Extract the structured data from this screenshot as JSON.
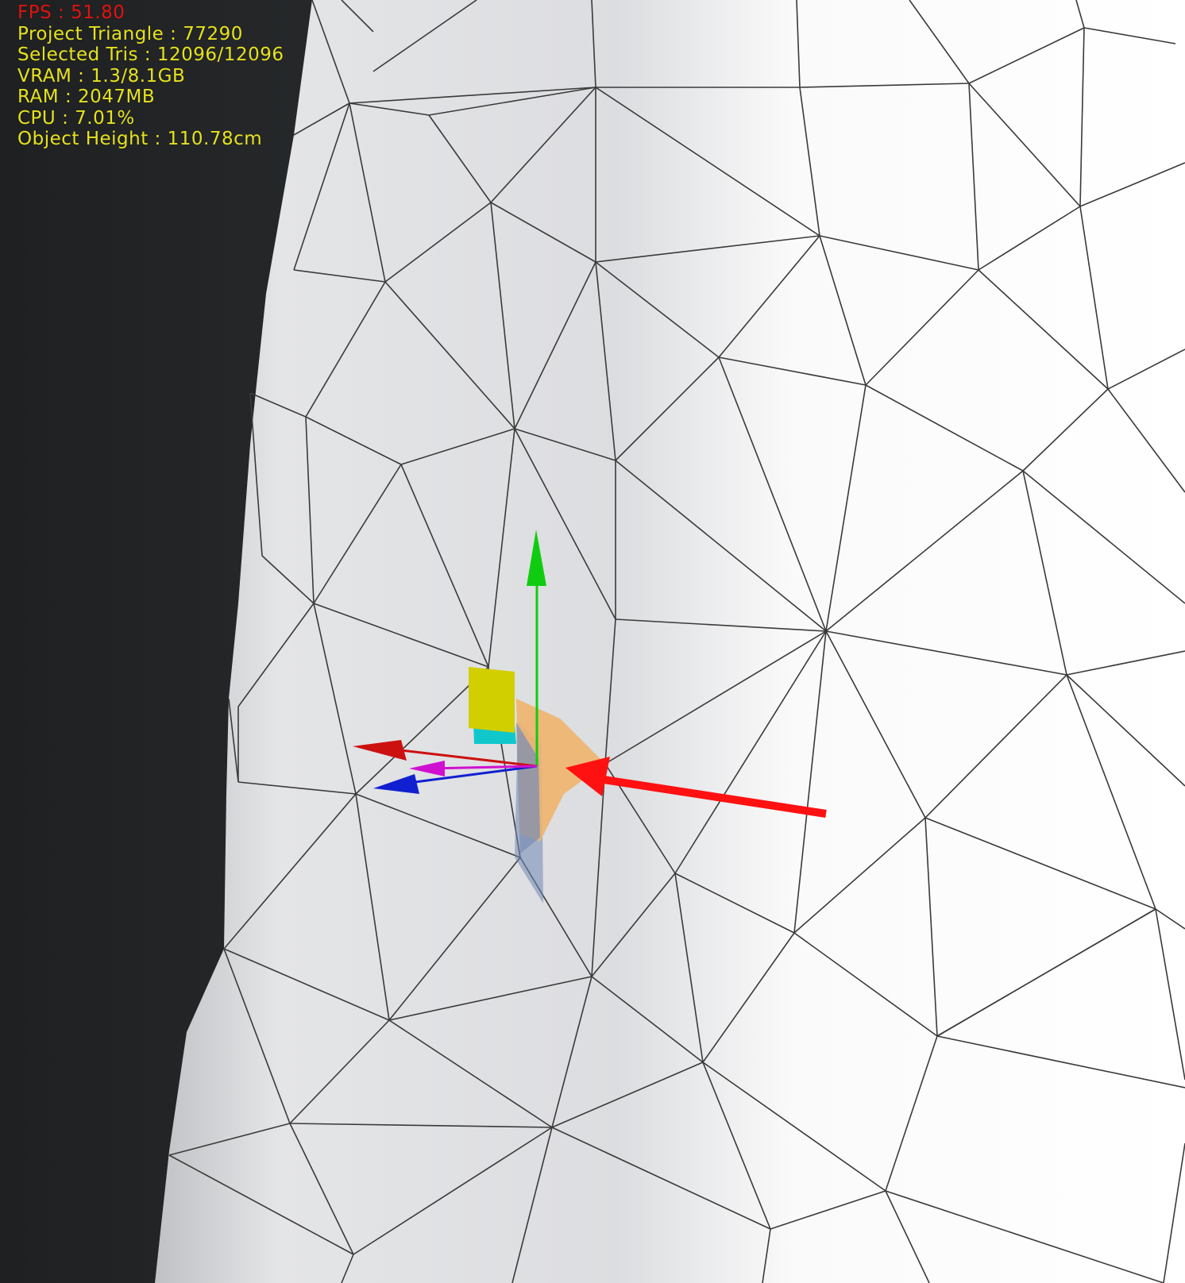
{
  "hud": {
    "fps": {
      "label": "FPS",
      "value": "51.80",
      "color": "#e0140f"
    },
    "lines": [
      {
        "label": "Project Triangle",
        "value": "77290"
      },
      {
        "label": "Selected Tris",
        "value": "12096/12096"
      },
      {
        "label": "VRAM",
        "value": "1.3/8.1GB"
      },
      {
        "label": "RAM",
        "value": "2047MB"
      },
      {
        "label": "CPU",
        "value": "7.01%"
      },
      {
        "label": "Object Height",
        "value": "110.78cm"
      }
    ],
    "text_color": "#e6e21e"
  },
  "viewport": {
    "background_color": "#2b2e30",
    "mesh_color": "#f2f2f2",
    "wire_color": "#3a3a3a",
    "selected_triangle_color": "#f0b46e",
    "annotation_arrow_color": "#ff1111"
  },
  "gizmo": {
    "axes": [
      {
        "name": "y-axis",
        "color": "#10cc10"
      },
      {
        "name": "x-axis",
        "color": "#cc1010"
      },
      {
        "name": "z-axis",
        "color": "#1020d0"
      },
      {
        "name": "plane-axis",
        "color": "#d010d0"
      }
    ],
    "plane_handles": [
      {
        "name": "xy-plane-handle",
        "color": "#d2cf00"
      },
      {
        "name": "yz-plane-handle",
        "color": "#10c8cc"
      }
    ]
  }
}
